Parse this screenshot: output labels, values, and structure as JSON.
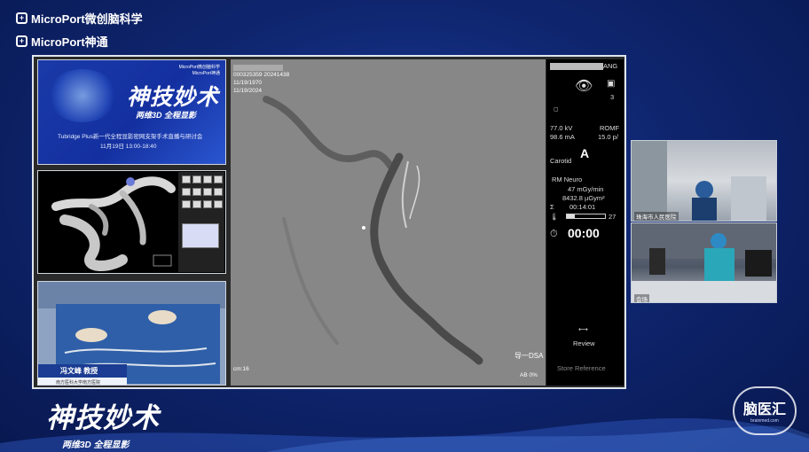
{
  "brand": {
    "logo1": "MicroPort微创脑科学",
    "logo2": "MicroPort神通"
  },
  "slide": {
    "brand_small1": "MicroPort微创脑科学",
    "brand_small2": "MicroPort神通",
    "title": "神技妙术",
    "subtitle": "两维3D 全程显影",
    "line1": "Tubridge Plus新一代全程显影密网支架手术直播与研讨会",
    "line2": "11月19日 13:00-18:40"
  },
  "surgeon": {
    "name": "冯文峰 教授",
    "hospital": "南方医科大学南方医院"
  },
  "dsa": {
    "id_line": "000325359 20241438",
    "dob": "11/19/1970",
    "date": "11/19/2024",
    "bottom_left": "cm:16",
    "label_right": "导一DSA",
    "ab": "AB 0%"
  },
  "side_panel": {
    "header": "ANG",
    "count": "3",
    "kv": "77.0 kV",
    "roi": "ROMF",
    "ma": "98.6 mA",
    "fps": "15.0 p/",
    "protocol": "Carotid",
    "letter": "A",
    "program": "RM Neuro",
    "dose_rate": "47 mGy/min",
    "dap": "8432.8 µGym²",
    "time": "00:14:01",
    "bar_pct": "27",
    "timer": "00:00",
    "review": "Review",
    "store": "Store Reference"
  },
  "video": {
    "label1": "珠海市人民医院",
    "label2": "会场"
  },
  "footer": {
    "title": "神技妙术",
    "subtitle": "两维3D 全程显影",
    "logo": "脑医汇",
    "logo_sub": "brainmed.com"
  },
  "colors": {
    "bg": "#0f2670",
    "panel": "#000000",
    "xray": "#878787"
  }
}
